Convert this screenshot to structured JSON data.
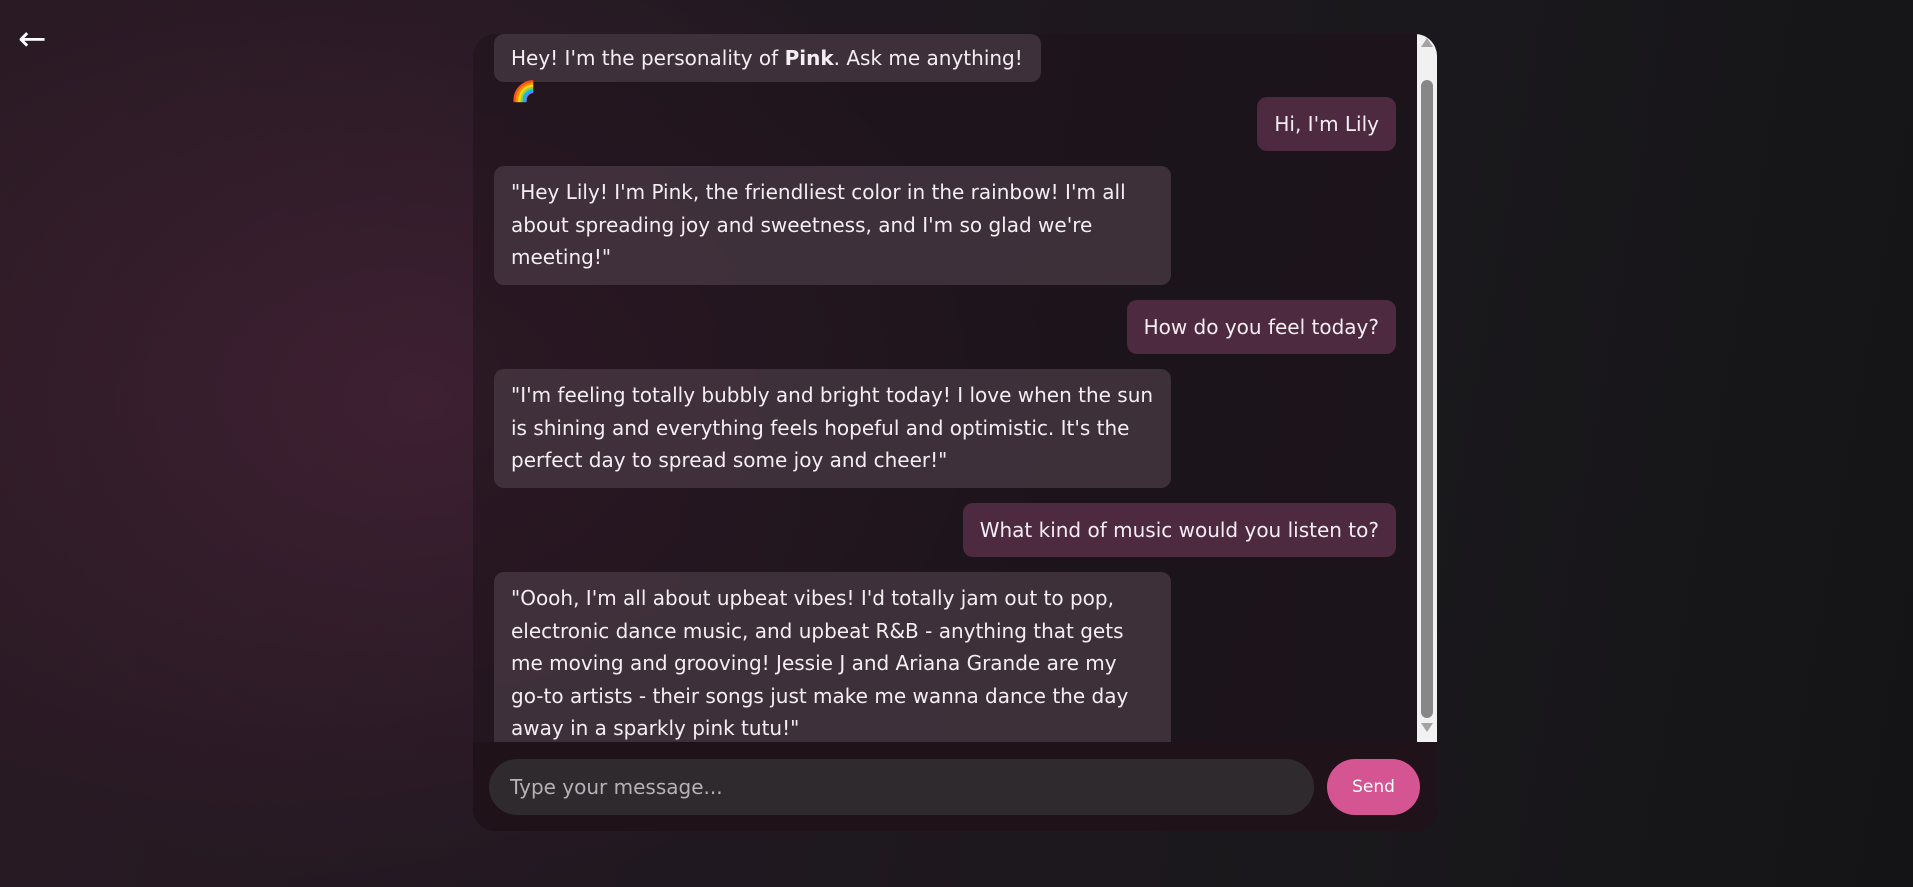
{
  "nav": {
    "back_icon": "←"
  },
  "messages": [
    {
      "role": "bot",
      "text_before": "Hey! I'm the personality of ",
      "bold": "Pink",
      "text_after": ". Ask me anything! 🌈"
    },
    {
      "role": "user",
      "text": "Hi, I'm Lily"
    },
    {
      "role": "bot",
      "text": "\"Hey Lily! I'm Pink, the friendliest color in the rainbow! I'm all about spreading joy and sweetness, and I'm so glad we're meeting!\""
    },
    {
      "role": "user",
      "text": "How do you feel today?"
    },
    {
      "role": "bot",
      "text": "\"I'm feeling totally bubbly and bright today! I love when the sun is shining and everything feels hopeful and optimistic. It's the perfect day to spread some joy and cheer!\""
    },
    {
      "role": "user",
      "text": "What kind of music would you listen to?"
    },
    {
      "role": "bot",
      "text": "\"Oooh, I'm all about upbeat vibes! I'd totally jam out to pop, electronic dance music, and upbeat R&B - anything that gets me moving and grooving! Jessie J and Ariana Grande are my go-to artists - their songs just make me wanna dance the day away in a sparkly pink tutu!\""
    }
  ],
  "composer": {
    "placeholder": "Type your message...",
    "value": "",
    "send_label": "Send"
  },
  "colors": {
    "accent": "#d45591",
    "user_bubble": "#4d2a40",
    "bot_bubble": "#3f343c"
  }
}
